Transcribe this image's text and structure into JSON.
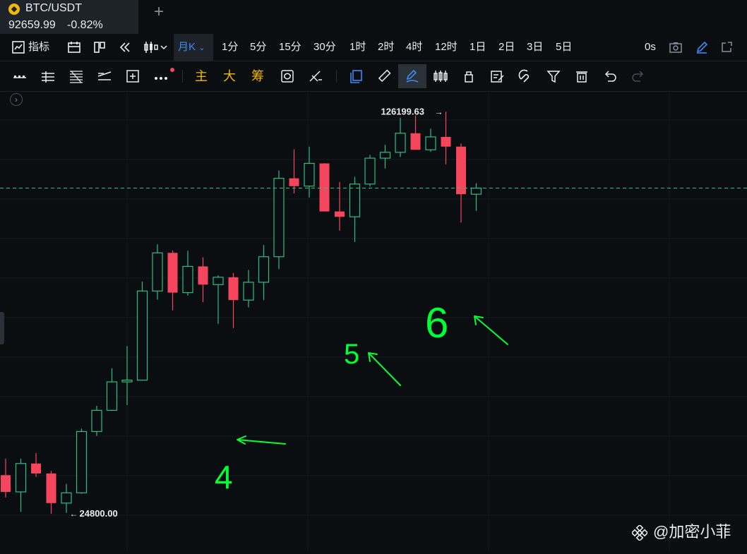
{
  "tab": {
    "pair": "BTC/USDT",
    "price": "92659.99",
    "change": "-0.82%"
  },
  "toolbar": {
    "indicators_label": "指标",
    "interval_active": "月K",
    "intervals": [
      "1分",
      "5分",
      "15分",
      "30分",
      "1时",
      "2时",
      "4时",
      "12时",
      "1日",
      "2日",
      "3日",
      "5日"
    ],
    "countdown": "0s",
    "chips": [
      "主",
      "大",
      "筹"
    ]
  },
  "icons": {
    "row1": [
      "chart-style-icon",
      "calendar-icon",
      "layout-icon",
      "rewind-icon",
      "candle-type-icon",
      "chevron-down-icon",
      "camera-icon",
      "pencil-icon",
      "popout-icon"
    ],
    "row2": [
      "horizontal-ray-icon",
      "parallel-lines-icon",
      "fib-levels-icon",
      "trend-angle-icon",
      "measure-icon",
      "more-icon",
      "cycle-icon",
      "cross-tools-icon",
      "panels-icon",
      "ruler-icon",
      "draw-mode-icon",
      "candle-compare-icon",
      "lock-icon",
      "note-icon",
      "magnet-icon",
      "filter-icon",
      "trash-icon",
      "undo-icon",
      "redo-icon"
    ]
  },
  "colors": {
    "up": "#2ebd85",
    "down": "#f6465d",
    "annotation": "#00ff33",
    "accent": "#3c8cf0",
    "brand": "#f0b90b"
  },
  "chart_data": {
    "type": "candlestick",
    "interval": "月K",
    "candles": [
      {
        "o": 29000,
        "h": 31000,
        "l": 26500,
        "c": 27100
      },
      {
        "o": 27100,
        "h": 31000,
        "l": 25000,
        "c": 30400
      },
      {
        "o": 30400,
        "h": 31700,
        "l": 28800,
        "c": 29200
      },
      {
        "o": 29200,
        "h": 29500,
        "l": 24800,
        "c": 25900
      },
      {
        "o": 25900,
        "h": 28000,
        "l": 24900,
        "c": 27000
      },
      {
        "o": 27000,
        "h": 35000,
        "l": 26900,
        "c": 34600
      },
      {
        "o": 34600,
        "h": 38400,
        "l": 34000,
        "c": 37700
      },
      {
        "o": 37700,
        "h": 44700,
        "l": 37600,
        "c": 42300
      },
      {
        "o": 42300,
        "h": 48900,
        "l": 38500,
        "c": 42600
      },
      {
        "o": 42600,
        "h": 63500,
        "l": 42500,
        "c": 61100
      },
      {
        "o": 61100,
        "h": 73800,
        "l": 59000,
        "c": 71300
      },
      {
        "o": 71300,
        "h": 72000,
        "l": 56500,
        "c": 60700
      },
      {
        "o": 60700,
        "h": 71900,
        "l": 60000,
        "c": 67500
      },
      {
        "o": 67500,
        "h": 70000,
        "l": 58400,
        "c": 62700
      },
      {
        "o": 62700,
        "h": 65100,
        "l": 53500,
        "c": 64600
      },
      {
        "o": 64600,
        "h": 65700,
        "l": 52600,
        "c": 58900
      },
      {
        "o": 58900,
        "h": 66500,
        "l": 57200,
        "c": 63300
      },
      {
        "o": 63300,
        "h": 73600,
        "l": 58900,
        "c": 70200
      },
      {
        "o": 70200,
        "h": 99500,
        "l": 66800,
        "c": 96400
      },
      {
        "o": 96400,
        "h": 108400,
        "l": 90700,
        "c": 93400
      },
      {
        "o": 93400,
        "h": 109600,
        "l": 89200,
        "c": 102400
      },
      {
        "o": 102400,
        "h": 102500,
        "l": 91200,
        "c": 84300
      },
      {
        "o": 84300,
        "h": 95000,
        "l": 78000,
        "c": 82500
      },
      {
        "o": 82500,
        "h": 97000,
        "l": 74500,
        "c": 94200
      },
      {
        "o": 94200,
        "h": 106000,
        "l": 93300,
        "c": 104600
      },
      {
        "o": 104600,
        "h": 110400,
        "l": 100300,
        "c": 107100
      },
      {
        "o": 107100,
        "h": 123200,
        "l": 105100,
        "c": 115700
      },
      {
        "o": 115700,
        "h": 124400,
        "l": 112000,
        "c": 108200
      },
      {
        "o": 108200,
        "h": 117900,
        "l": 107300,
        "c": 114000
      },
      {
        "o": 114000,
        "h": 126199.63,
        "l": 102000,
        "c": 109600
      },
      {
        "o": 109600,
        "h": 111000,
        "l": 80600,
        "c": 90400
      },
      {
        "o": 90400,
        "h": 94500,
        "l": 84500,
        "c": 92659.99
      }
    ],
    "current_price": 92659.99,
    "high_label": "126199.63",
    "low_label": "24800.00",
    "y_range": [
      22000,
      133000
    ],
    "grid": true,
    "annotations": [
      "4",
      "5",
      "6"
    ]
  },
  "watermark": {
    "text": "@加密小菲"
  }
}
